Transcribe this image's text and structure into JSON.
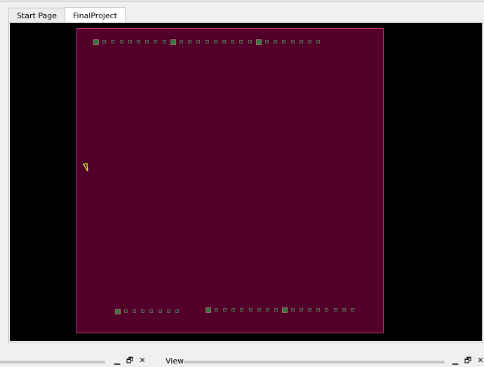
{
  "tabs": [
    {
      "label": "Start Page",
      "active": false
    },
    {
      "label": "FinalProject",
      "active": true
    }
  ],
  "board": {
    "background_color": "#52002a",
    "outline_color": "#c43a7e",
    "pad_color": "#2f7a38"
  },
  "bottom_panel": {
    "view_label": "View",
    "minimize_icon": "minimize-icon",
    "restore_icon": "restore-icon",
    "close_icon": "close-icon"
  }
}
